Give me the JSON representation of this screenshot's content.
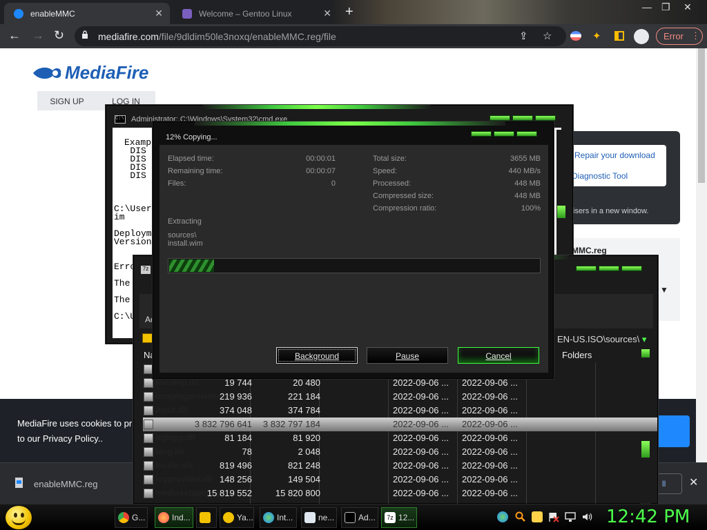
{
  "browser": {
    "tabs": [
      {
        "title": "enableMMC",
        "active": true
      },
      {
        "title": "Welcome – Gentoo Linux",
        "active": false
      }
    ],
    "url_domain": "mediafire.com",
    "url_path": "/file/9dldim50le3noxq/enableMMC.reg/file",
    "error_label": "Error",
    "accent": "#f28b82"
  },
  "page": {
    "logo_text": "MediaFire",
    "signup": "SIGN UP",
    "login": "LOG IN",
    "repair": "Repair your download",
    "diagnostic": "Diagnostic Tool",
    "note": "isers in a new window.",
    "filename_partial": "MMC.reg",
    "cookie_line1": "MediaFire uses cookies to pr",
    "cookie_line2": "to our Privacy Policy.."
  },
  "downloads": {
    "filename": "enableMMC.reg",
    "show_all": "ll"
  },
  "cmd": {
    "title": "Administrator: C:\\Windows\\System32\\cmd.exe",
    "lines": [
      "Examp",
      "   DIS",
      "   DIS",
      "   DIS",
      "   DIS",
      "C:\\User",
      "im",
      "Deploym",
      "Version",
      "Erro",
      "The",
      "The",
      "C:\\U"
    ]
  },
  "sevenzip": {
    "add_label": "Ad",
    "path": "EN-US.ISO\\sources\\",
    "col_name": "Na",
    "col_folders": "Folders",
    "rows": [
      {
        "name": "",
        "size": "",
        "packed": "",
        "modified": "",
        "created": ""
      },
      {
        "name": "iiscomp.dll",
        "size": "19 744",
        "packed": "20 480",
        "modified": "2022-09-06 ...",
        "created": "2022-09-06 ..."
      },
      {
        "name": "imagingprovider.dll",
        "size": "219 936",
        "packed": "221 184",
        "modified": "2022-09-06 ...",
        "created": "2022-09-06 ..."
      },
      {
        "name": "input.dll",
        "size": "374 048",
        "packed": "374 784",
        "modified": "2022-09-06 ...",
        "created": "2022-09-06 ..."
      },
      {
        "name": "",
        "size": "3 832 796 641",
        "packed": "3 832 797 184",
        "modified": "2022-09-06 ...",
        "created": "2022-09-06 ..."
      },
      {
        "name": "itgtupg.dll",
        "size": "81 184",
        "packed": "81 920",
        "modified": "2022-09-06 ...",
        "created": "2022-09-06 ..."
      },
      {
        "name": "lang.ini",
        "size": "78",
        "packed": "2 048",
        "modified": "2022-09-06 ...",
        "created": "2022-09-06 ..."
      },
      {
        "name": "locale.nls",
        "size": "819 496",
        "packed": "821 248",
        "modified": "2022-09-06 ...",
        "created": "2022-09-06 ..."
      },
      {
        "name": "logprovider.dll",
        "size": "148 256",
        "packed": "149 504",
        "modified": "2022-09-06 ...",
        "created": "2022-09-06 ..."
      },
      {
        "name": "mediasetupuimgr.dll",
        "size": "15 819 552",
        "packed": "15 820 800",
        "modified": "2022-09-06 ...",
        "created": "2022-09-06 ..."
      }
    ]
  },
  "progress": {
    "title": "12% Copying...",
    "percent": 12,
    "left": [
      {
        "label": "Elapsed time:",
        "value": "00:00:01"
      },
      {
        "label": "Remaining time:",
        "value": "00:00:07"
      },
      {
        "label": "Files:",
        "value": "0"
      }
    ],
    "right": [
      {
        "label": "Total size:",
        "value": "3655 MB"
      },
      {
        "label": "Speed:",
        "value": "440 MB/s"
      },
      {
        "label": "Processed:",
        "value": "448 MB"
      },
      {
        "label": "Compressed size:",
        "value": "448 MB"
      },
      {
        "label": "Compression ratio:",
        "value": "100%"
      }
    ],
    "action": "Extracting",
    "path_line1": "sources\\",
    "path_line2": "install.wim",
    "btn_background": "Background",
    "btn_pause": "Pause",
    "btn_cancel": "Cancel",
    "accent": "#3cff3c"
  },
  "taskbar": {
    "tasks": [
      {
        "label": "G...",
        "icon": "chrome-icon"
      },
      {
        "label": "Ind...",
        "icon": "firefox-icon"
      },
      {
        "label": "",
        "icon": "folder-icon"
      },
      {
        "label": "Ya...",
        "icon": "yahoo-icon"
      },
      {
        "label": "Int...",
        "icon": "internet-icon"
      },
      {
        "label": "ne...",
        "icon": "notepad-icon"
      },
      {
        "label": "Ad...",
        "icon": "cmd-icon"
      },
      {
        "label": "12...",
        "icon": "7zip-icon"
      }
    ],
    "clock": "12:42 PM",
    "clock_color": "#4cff4c"
  }
}
